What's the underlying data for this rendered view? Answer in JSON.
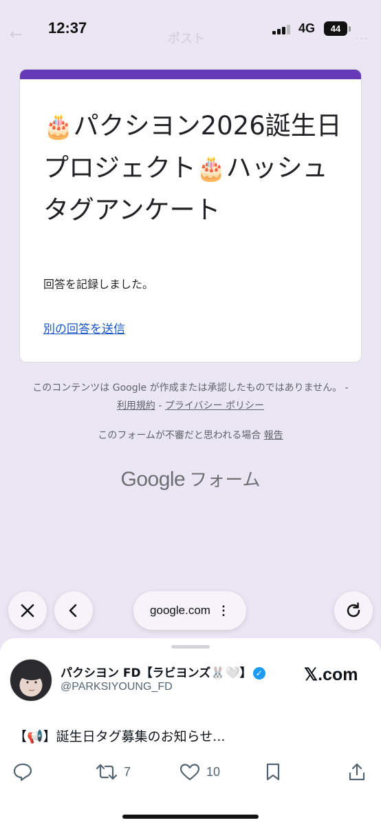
{
  "status_bar": {
    "time": "12:37",
    "network": "4G",
    "battery": "44",
    "ghost_back": "←",
    "ghost_title": "ポスト",
    "ghost_right": "…"
  },
  "form": {
    "accent_color": "#673ab7",
    "title_icon": "cake-icon",
    "title_cake_emoji": "🎂",
    "title_part1": "パクシヨン2026誕生日プロジェクト",
    "title_part2": "ハッシュタグアンケート",
    "confirmation": "回答を記録しました。",
    "another_response_link": "別の回答を送信"
  },
  "footer": {
    "disclaimer_text": "このコンテンツは Google が作成または承認したものではありません。 - ",
    "terms_link": "利用規約",
    "separator": " - ",
    "privacy_link": "プライバシー ポリシー",
    "report_text": "このフォームが不審だと思われる場合 ",
    "report_link": "報告",
    "brand_google": "Google",
    "brand_forms": "フォーム"
  },
  "browser": {
    "url": "google.com",
    "more_glyph": "⋮",
    "icons": [
      "close-icon",
      "back-chevron-icon",
      "reload-icon"
    ]
  },
  "tweet": {
    "author_name": "パクシヨン FD【ラビヨンズ🐰🤍】",
    "verified_glyph": "✓",
    "author_handle": "@PARKSIYOUNG_FD",
    "site_label": "𝕏.com",
    "text": "【📢】誕生日タグ募集のお知らせ...",
    "retweets": "7",
    "likes": "10",
    "accent_color": "#1d9bf0"
  }
}
